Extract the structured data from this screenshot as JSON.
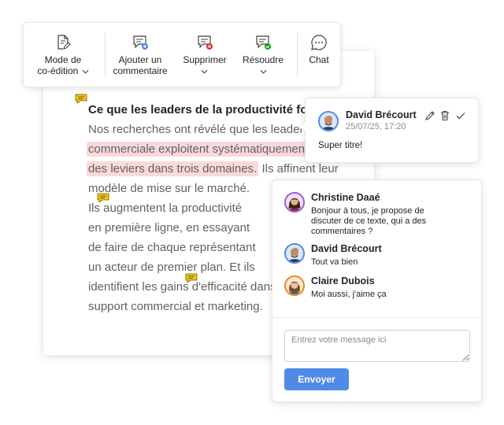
{
  "toolbar": {
    "coedit_label_line1": "Mode de",
    "coedit_label_line2": "co-édition",
    "add_comment_line1": "Ajouter un",
    "add_comment_line2": "commentaire",
    "delete_label": "Supprimer",
    "resolve_label": "Résoudre",
    "chat_label": "Chat"
  },
  "document": {
    "title": "Ce que les leaders de la productivité fon",
    "lines": [
      "Nos recherches ont révélé que les leader",
      "commerciale exploitent systématiquement",
      "des leviers dans trois domaines.",
      "modèle de mise sur le marché.",
      "Ils augmentent la productivité",
      "en première ligne, en essayant",
      "de faire de chaque représentant",
      "un acteur de premier plan. Et ils",
      "identifient les gains d'efficacité dans",
      "support commercial et marketing."
    ],
    "line3_tail": " Ils affinent leur"
  },
  "comment": {
    "author": "David Brécourt",
    "timestamp": "25/07/25, 17:20",
    "text": "Super titre!"
  },
  "chat": {
    "messages": [
      {
        "author": "Christine Daaé",
        "text": "Bonjour à tous, je propose de discuter de ce texte, qui a des commentaires ?"
      },
      {
        "author": "David Brécourt",
        "text": "Tout va bien"
      },
      {
        "author": "Claire Dubois",
        "text": "Moi aussi, j'aime ça"
      }
    ],
    "input_placeholder": "Entrez votre message ici",
    "send_label": "Envoyer"
  },
  "colors": {
    "accent": "#4f8ae6",
    "highlight": "#fbd9da",
    "marker": "#f2c811",
    "delete_badge": "#d13438",
    "resolve_badge": "#13a10e"
  }
}
